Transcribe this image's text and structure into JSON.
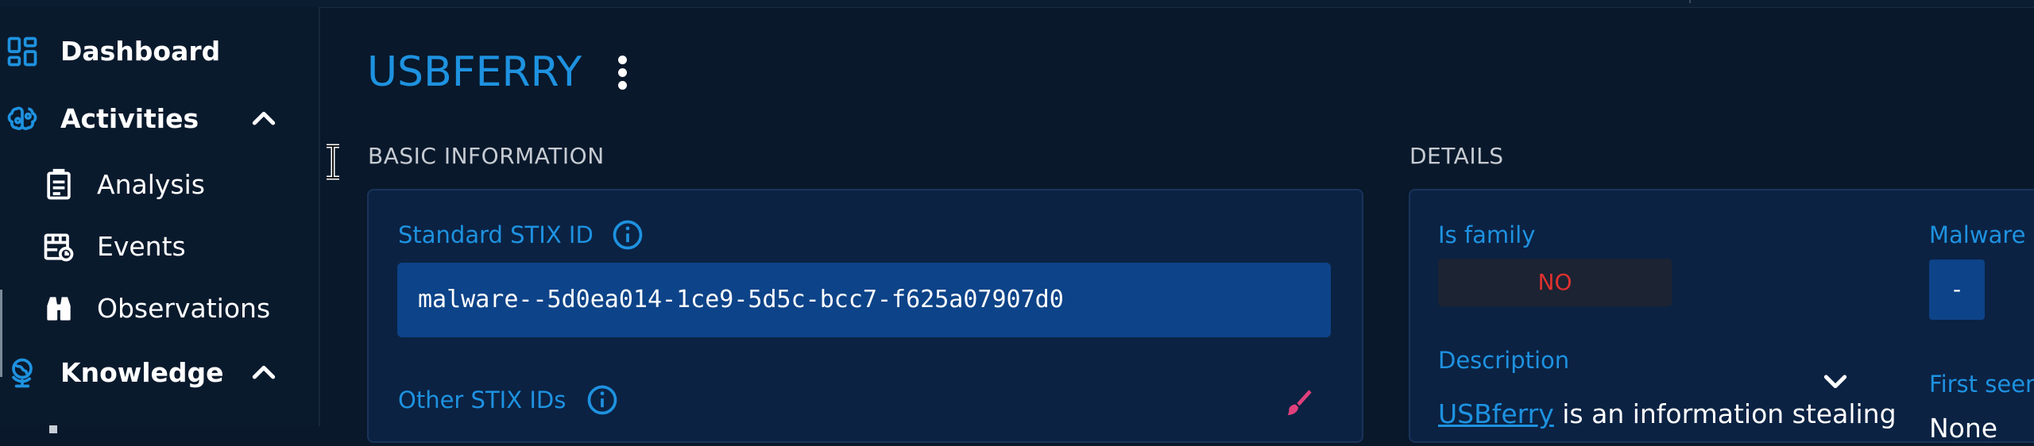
{
  "sidebar": {
    "items": [
      {
        "label": "Dashboard",
        "icon": "dashboard-icon"
      },
      {
        "label": "Activities",
        "icon": "brain-icon",
        "expanded": true
      },
      {
        "label": "Analysis",
        "icon": "report-icon"
      },
      {
        "label": "Events",
        "icon": "calendar-icon"
      },
      {
        "label": "Observations",
        "icon": "binoculars-icon"
      },
      {
        "label": "Knowledge",
        "icon": "globe-icon",
        "expanded": true
      }
    ]
  },
  "entity": {
    "title": "USBFERRY"
  },
  "basic_information": {
    "section_title": "BASIC INFORMATION",
    "standard_stix_id_label": "Standard STIX ID",
    "standard_stix_id_value": "malware--5d0ea014-1ce9-5d5c-bcc7-f625a07907d0",
    "other_stix_ids_label": "Other STIX IDs"
  },
  "details": {
    "section_title": "DETAILS",
    "is_family_label": "Is family",
    "is_family_value": "NO",
    "malware_types_label": "Malware",
    "malware_types_value": "-",
    "description_label": "Description",
    "description_link": "USBferry",
    "description_text": " is an information stealing",
    "first_seen_label": "First seen",
    "first_seen_value": "None"
  },
  "colors": {
    "accent": "#1e92e0",
    "background": "#09182b",
    "panel": "#0b2243",
    "stix_box": "#0d4388",
    "danger": "#e0312f"
  }
}
